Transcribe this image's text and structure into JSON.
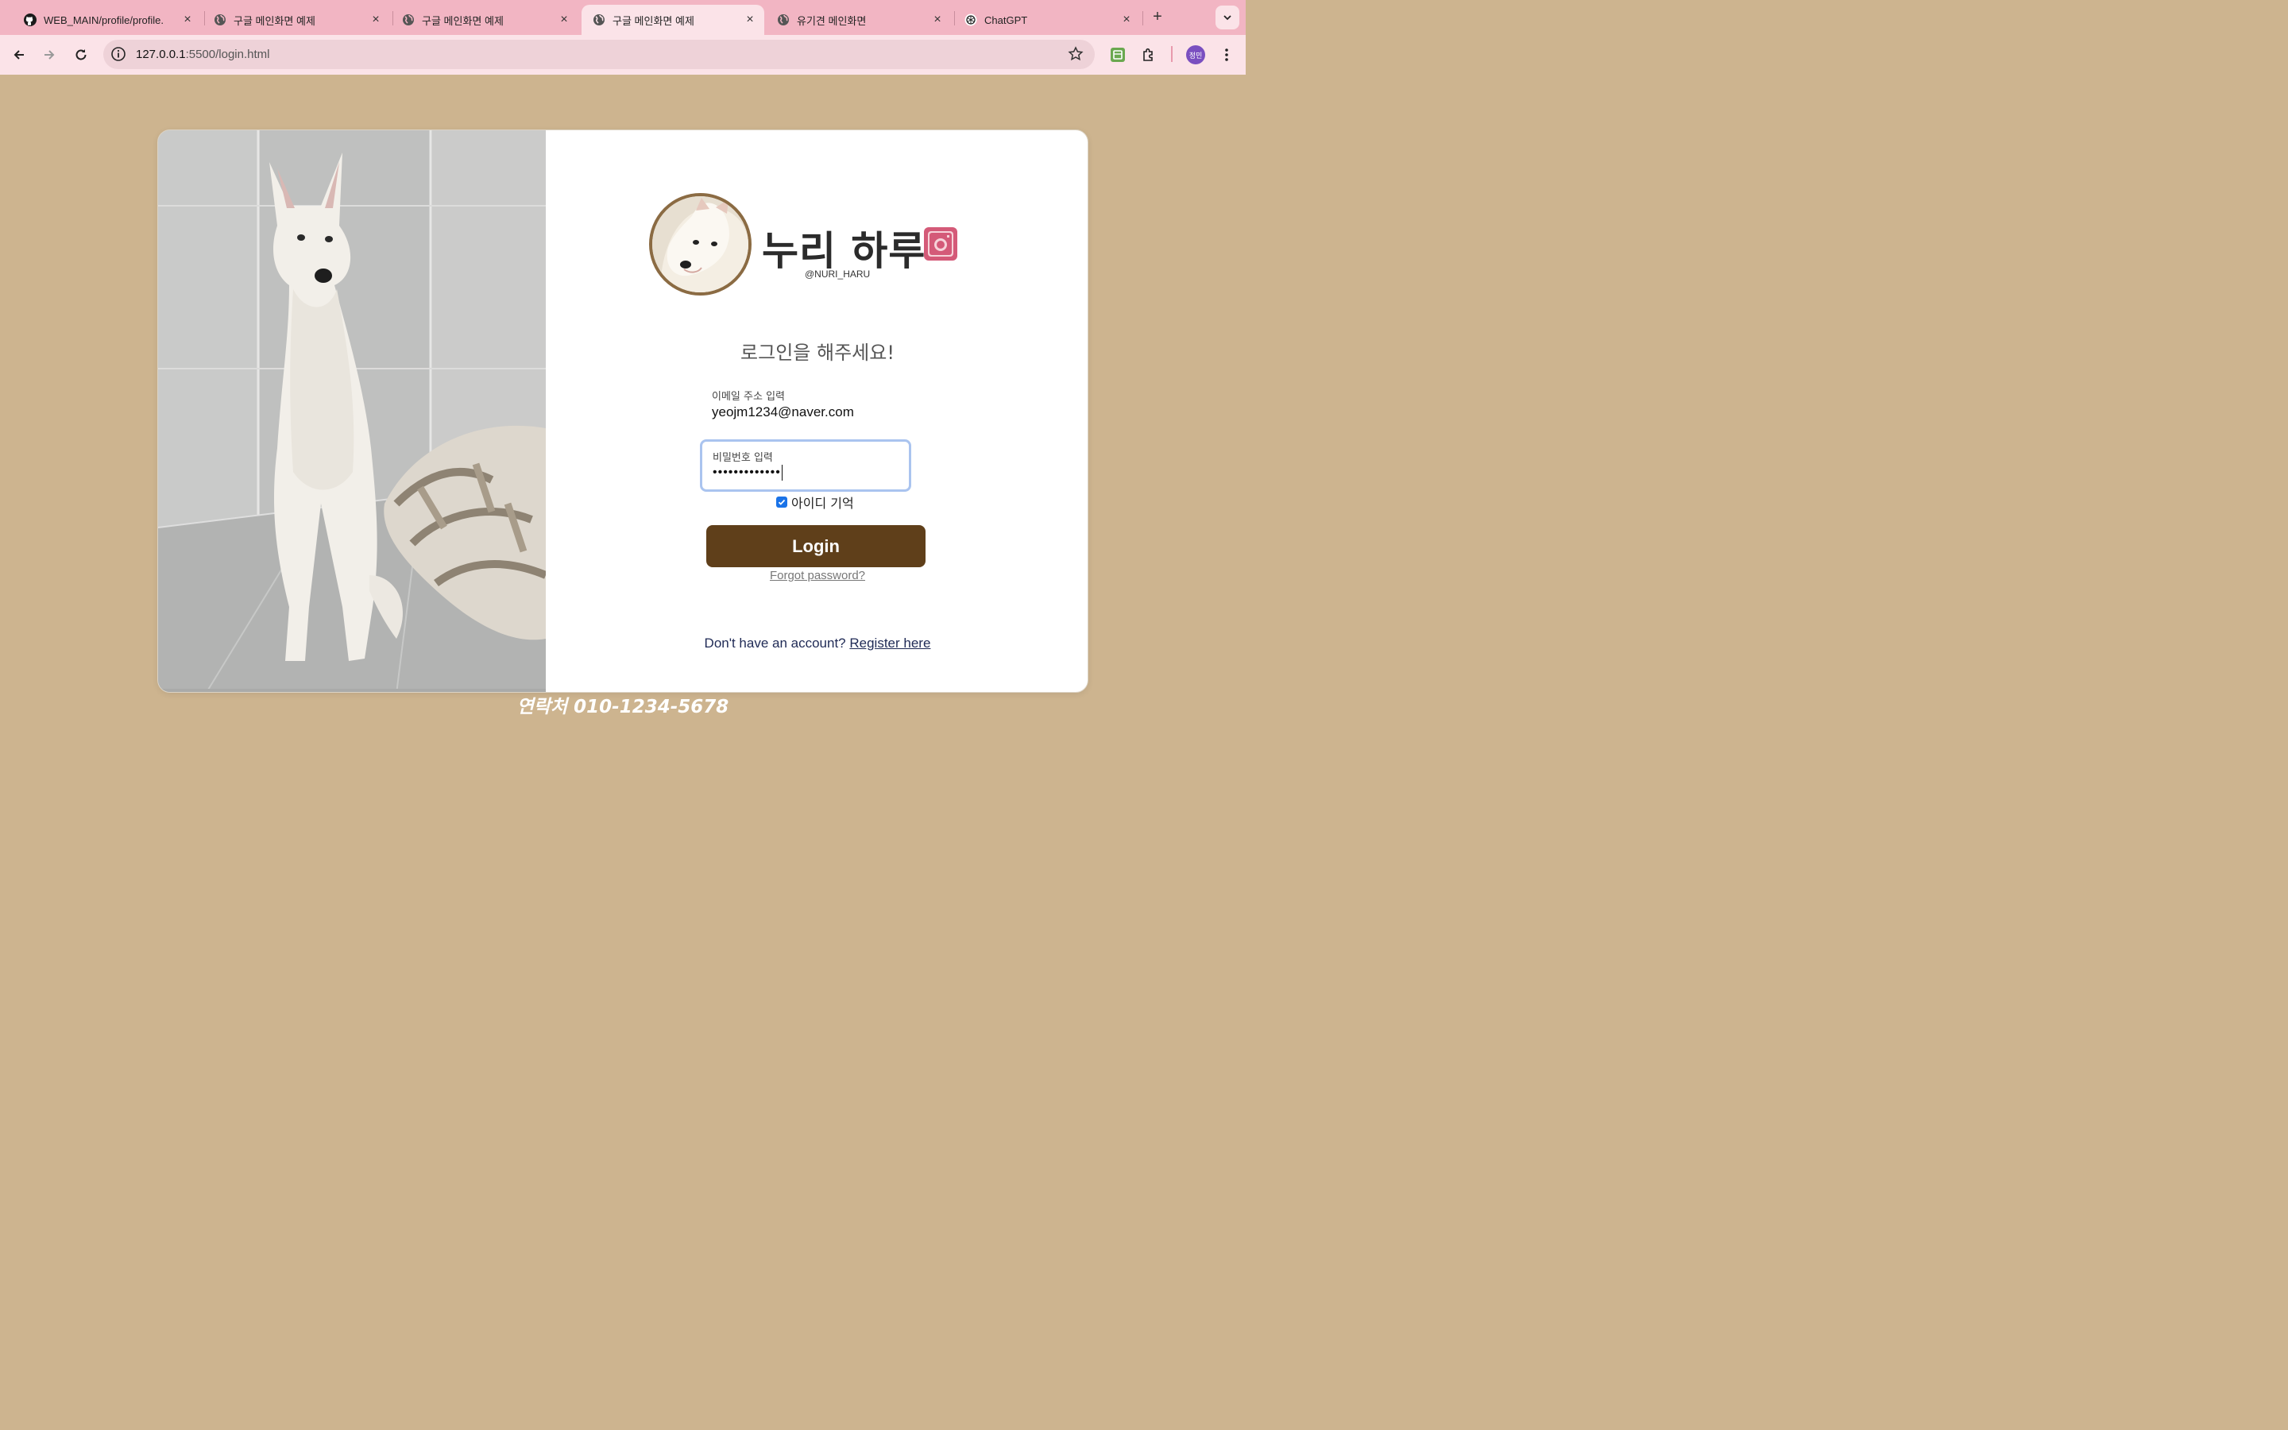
{
  "browser": {
    "tabs": [
      {
        "title": "WEB_MAIN/profile/profile.",
        "icon": "github-icon",
        "active": false
      },
      {
        "title": "구글 메인화면 예제",
        "icon": "globe-icon",
        "active": false
      },
      {
        "title": "구글 메인화면 예제",
        "icon": "globe-icon",
        "active": false
      },
      {
        "title": "구글 메인화면 예제",
        "icon": "globe-icon",
        "active": true
      },
      {
        "title": "유기견 메인화면",
        "icon": "globe-icon",
        "active": false
      },
      {
        "title": "ChatGPT",
        "icon": "chatgpt-icon",
        "active": false
      }
    ],
    "url_host": "127.0.0.1",
    "url_rest": ":5500/login.html",
    "profile_initials": "정민",
    "colors": {
      "tabbar": "#f2b5c3",
      "toolbar": "#fbe3e8"
    }
  },
  "brand": {
    "name": "누리 하루",
    "handle": "@NURI_HARU"
  },
  "form": {
    "heading": "로그인을 해주세요!",
    "email_label": "이메일 주소 입력",
    "email_value": "yeojm1234@naver.com",
    "password_label": "비밀번호 입력",
    "password_mask": "•••••••••••••",
    "remember_label": "아이디 기억",
    "remember_checked": true,
    "login_label": "Login",
    "forgot_label": "Forgot password?",
    "no_account_text": "Don't have an account?",
    "register_label": "Register here"
  },
  "footer": {
    "contact": "연락처 010-1234-5678"
  },
  "colors": {
    "page_bg": "#cdb48f",
    "login_button": "#5f3f1a",
    "focus_ring": "#aac4ef"
  }
}
